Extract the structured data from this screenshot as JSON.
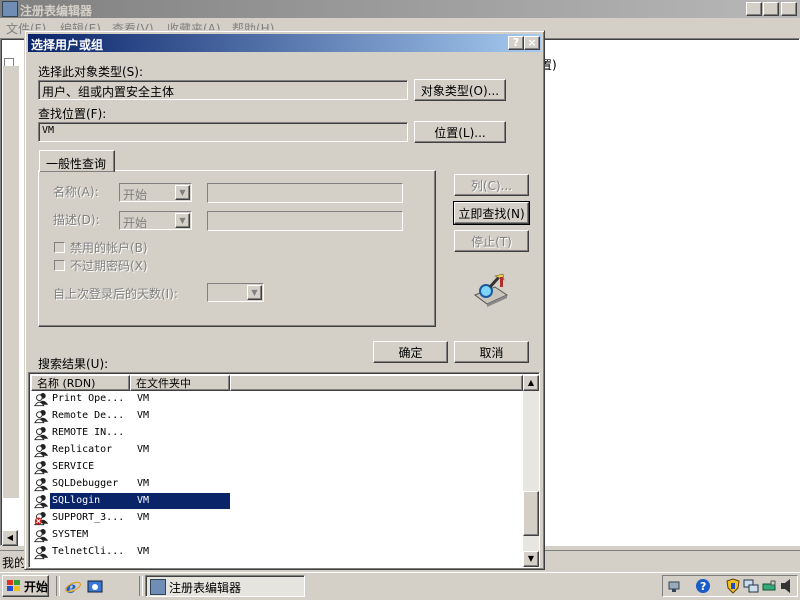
{
  "background_app": {
    "title": "注册表编辑器",
    "menu": [
      "文件(F)",
      "编辑(E)",
      "查看(V)",
      "收藏夹(A)",
      "帮助(H)"
    ],
    "right_pane_fragment": "置)",
    "status_fragment": "我的"
  },
  "dialog": {
    "title": "选择用户或组",
    "object_type_label": "选择此对象类型(S):",
    "object_type_value": "用户、组或内置安全主体",
    "object_types_button": "对象类型(O)...",
    "location_label": "查找位置(F):",
    "location_value": "VM",
    "location_button": "位置(L)...",
    "tab_label": "一般性查询",
    "name_label": "名称(A):",
    "name_combo": "开始",
    "desc_label": "描述(D):",
    "desc_combo": "开始",
    "disabled_accounts_label": "禁用的帐户(B)",
    "non_expiring_pwd_label": "不过期密码(X)",
    "days_since_logon_label": "自上次登录后的天数(I):",
    "columns_button": "列(C)...",
    "find_now_button": "立即查找(N)",
    "stop_button": "停止(T)",
    "ok_button": "确定",
    "cancel_button": "取消",
    "results_label": "搜索结果(U):",
    "columns": [
      "名称 (RDN)",
      "在文件夹中"
    ],
    "rows": [
      {
        "name": "Print Ope...",
        "folder": "VM",
        "icon": "group-icon",
        "selected": false
      },
      {
        "name": "Remote De...",
        "folder": "VM",
        "icon": "group-icon",
        "selected": false
      },
      {
        "name": "REMOTE IN...",
        "folder": "",
        "icon": "group-icon",
        "selected": false
      },
      {
        "name": "Replicator",
        "folder": "VM",
        "icon": "group-icon",
        "selected": false
      },
      {
        "name": "SERVICE",
        "folder": "",
        "icon": "group-icon",
        "selected": false
      },
      {
        "name": "SQLDebugger",
        "folder": "VM",
        "icon": "group-icon",
        "selected": false
      },
      {
        "name": "SQLlogin",
        "folder": "VM",
        "icon": "group-icon",
        "selected": true
      },
      {
        "name": "SUPPORT_3...",
        "folder": "VM",
        "icon": "disabled-user-icon",
        "selected": false
      },
      {
        "name": "SYSTEM",
        "folder": "",
        "icon": "group-icon",
        "selected": false
      },
      {
        "name": "TelnetCli...",
        "folder": "VM",
        "icon": "group-icon",
        "selected": false
      }
    ]
  },
  "taskbar": {
    "start_label": "开始",
    "task_label": "注册表编辑器"
  },
  "colors": {
    "selection": "#0a246a",
    "title_active_start": "#0a246a",
    "title_active_end": "#a6caf0",
    "face": "#d4d0c8"
  }
}
